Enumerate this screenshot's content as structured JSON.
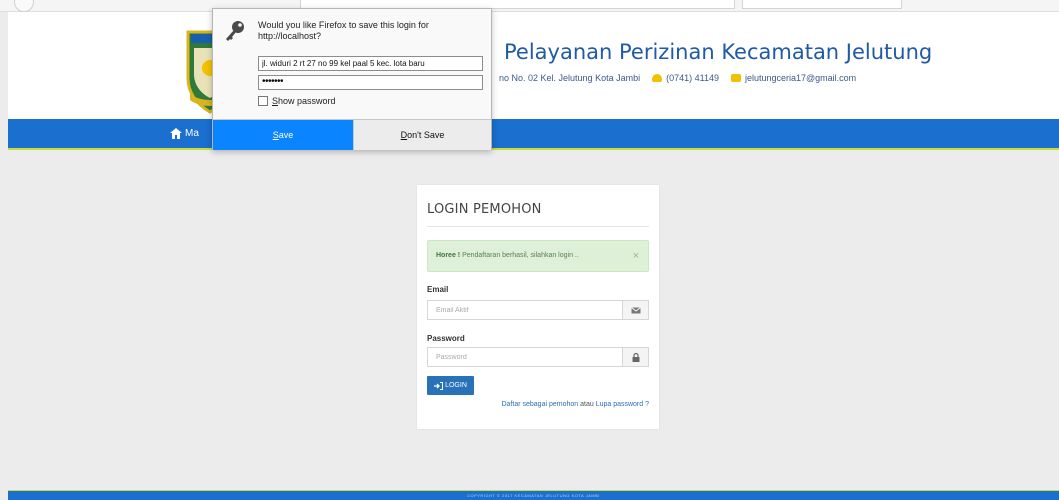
{
  "colors": {
    "brand_blue": "#1a6fcf",
    "nav_accent": "#c9dc3a",
    "title_blue": "#1f5aa6",
    "alert_bg": "#dff0d8",
    "button_blue": "#2a72b8",
    "ff_save_blue": "#0a84ff"
  },
  "header": {
    "title": "Pelayanan Perizinan Kecamatan Jelutung",
    "address": "no No. 02 Kel. Jelutung Kota Jambi",
    "phone": "(0741) 41149",
    "email": "jelutungceria17@gmail.com",
    "phone_icon": "phone-icon",
    "mail_icon": "envelope-icon"
  },
  "nav": {
    "home_label": "Ma",
    "home_icon": "home-icon"
  },
  "login": {
    "title": "LOGIN PEMOHON",
    "alert_strong": "Horee !",
    "alert_text": " Pendaftaran berhasil, silahkan login ..",
    "alert_close": "×",
    "email_label": "Email",
    "email_placeholder": "Email Aktif",
    "email_icon": "envelope-icon",
    "password_label": "Password",
    "password_placeholder": "Password",
    "password_icon": "lock-icon",
    "button_label": "LOGIN",
    "button_icon": "sign-in-icon",
    "register_link": "Daftar sebagai pemohon",
    "register_or": " atau ",
    "forgot_link": "Lupa password ?"
  },
  "footer": {
    "text": "COPYRIGHT © 2017 KECAMATAN JELUTUNG KOTA JAMBI"
  },
  "firefox_popup": {
    "question_line1": "Would you like Firefox to save this login for",
    "question_line2": "http://localhost?",
    "username_value": "jl. widuri 2 rt 27 no 99 kel paal 5 kec. lota baru",
    "password_mask": "•••••••",
    "show_password_prefix": "S",
    "show_password_rest": "how password",
    "save_label_u": "S",
    "save_label_rest": "ave",
    "dont_save_label_u": "D",
    "dont_save_label_rest": "on't Save",
    "key_icon": "key-icon"
  }
}
